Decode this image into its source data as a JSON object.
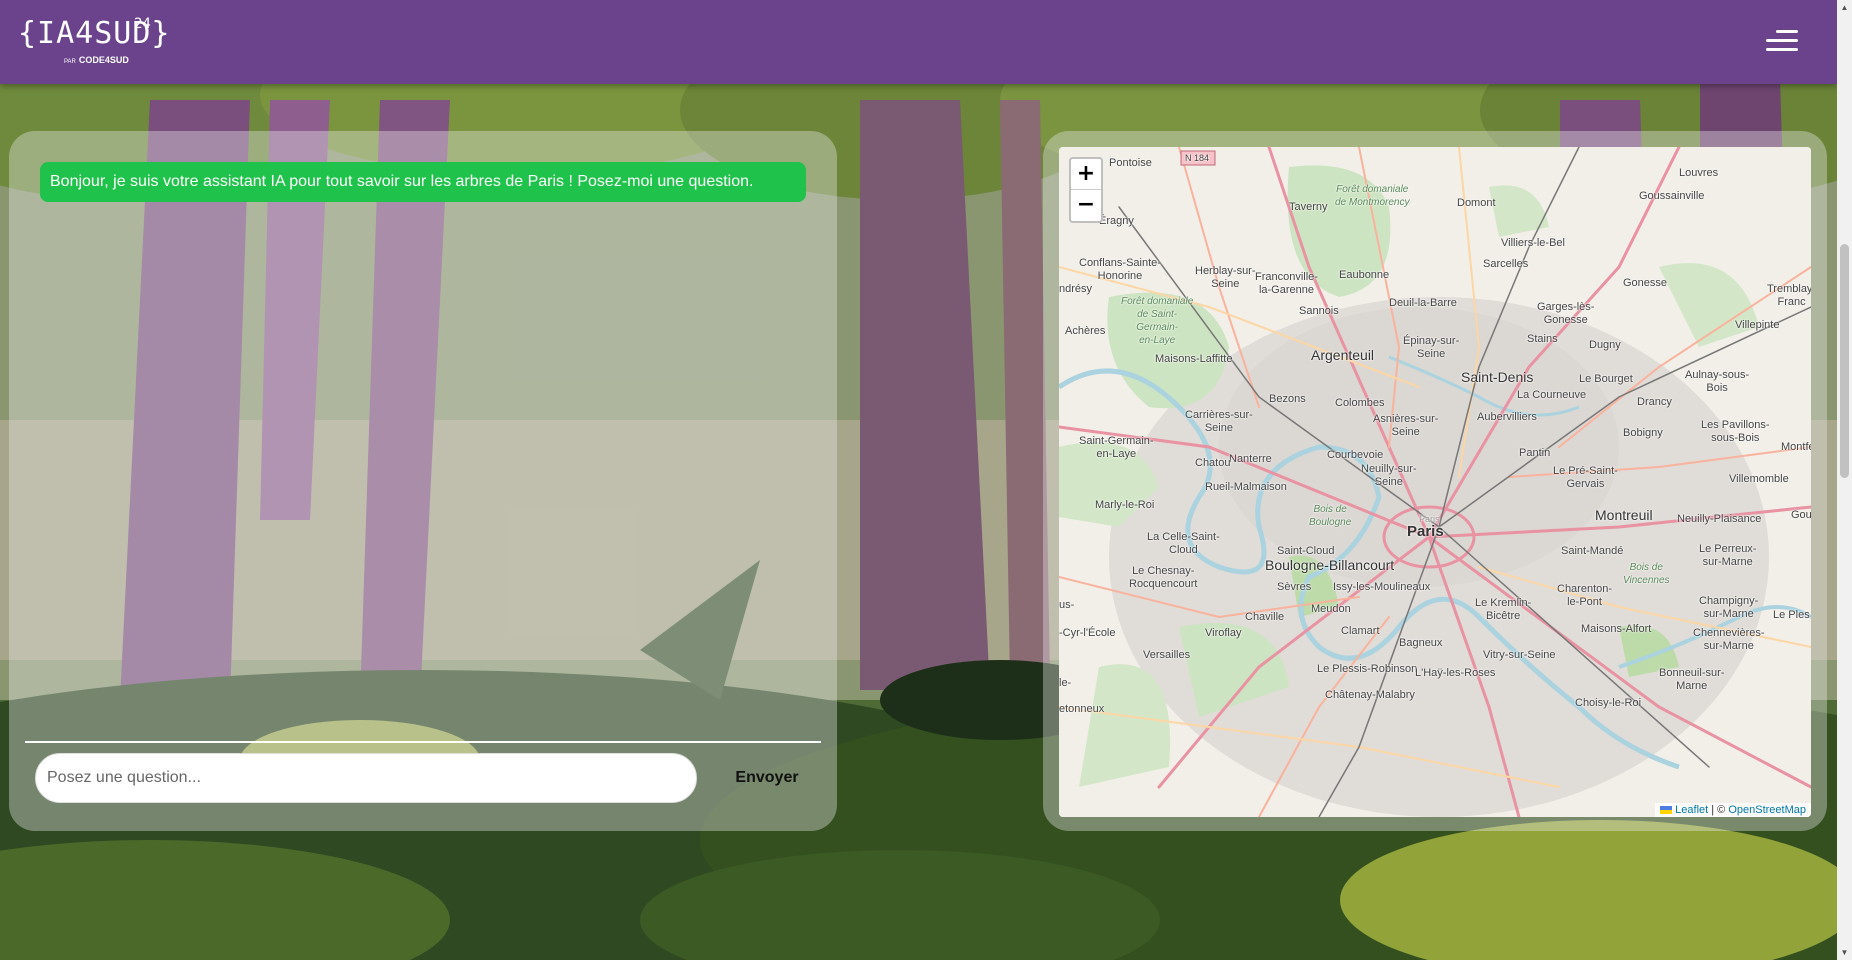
{
  "header": {
    "logo_text": "{IA4SUD}",
    "logo_superscript": "24",
    "logo_by_prefix": "PAR",
    "logo_by": "CODE4SUD",
    "menu_icon": "hamburger-menu-icon"
  },
  "chat": {
    "bot_message": "Bonjour, je suis votre assistant IA pour tout savoir sur les arbres de Paris ! Posez-moi une question.",
    "input_placeholder": "Posez une question...",
    "input_value": "",
    "send_label": "Envoyer",
    "bot_message_color": "#1fc24a"
  },
  "map": {
    "zoom_in": "+",
    "zoom_out": "−",
    "attribution_leaflet": "Leaflet",
    "attribution_separator": " | © ",
    "attribution_osm": "OpenStreetMap",
    "places": {
      "paris": "Paris",
      "argenteuil": "Argenteuil",
      "saint_denis": "Saint-Denis",
      "boulogne": "Boulogne-Billancourt",
      "montreuil": "Montreuil",
      "pontoise": "Pontoise",
      "taverny": "Taverny",
      "domont": "Domont",
      "louvres": "Louvres",
      "goussainville": "Goussainville",
      "eragny": "Éragny",
      "villiers_le_bel": "Villiers-le-Bel",
      "sarcelles": "Sarcelles",
      "gonesse": "Gonesse",
      "eaubonne": "Eaubonne",
      "franconville": "Franconville-\nla-Garenne",
      "herblay": "Herblay-sur-\nSeine",
      "conflans": "Conflans-Sainte-\nHonorine",
      "deuil": "Deuil-la-Barre",
      "garges": "Garges-lès-\nGonesse",
      "tremblay": "Tremblay-\nFranc",
      "villepinte": "Villepinte",
      "sannois": "Sannois",
      "stains": "Stains",
      "dugny": "Dugny",
      "epinay": "Épinay-sur-\nSeine",
      "acheres": "Achères",
      "maisons_laffitte": "Maisons-Laffitte",
      "aulnay": "Aulnay-sous-\nBois",
      "le_bourget": "Le Bourget",
      "bezons": "Bezons",
      "colombes": "Colombes",
      "la_courneuve": "La Courneuve",
      "drancy": "Drancy",
      "aubervilliers": "Aubervilliers",
      "asnieres": "Asnières-sur-\nSeine",
      "bobigny": "Bobigny",
      "pavillons": "Les Pavillons-\nsous-Bois",
      "carrieres": "Carrières-sur-\nSeine",
      "saint_germain": "Saint-Germain-\nen-Laye",
      "nanterre": "Nanterre",
      "courbevoie": "Courbevoie",
      "neuilly": "Neuilly-sur-\nSeine",
      "pantin": "Pantin",
      "pre_saint_gervais": "Le Pré-Saint-\nGervais",
      "chatou": "Chatou",
      "rueil": "Rueil-Malmaison",
      "villemomble": "Villemomble",
      "marly": "Marly-le-Roi",
      "neuilly_plaisance": "Neuilly-Plaisance",
      "la_celle": "La Celle-Saint-\nCloud",
      "saint_cloud": "Saint-Cloud",
      "saint_mande": "Saint-Mandé",
      "perreux": "Le Perreux-\nsur-Marne",
      "chesnay": "Le Chesnay-\nRocquencourt",
      "sevres": "Sèvres",
      "issy": "Issy-les-Moulineaux",
      "charenton": "Charenton-\nle-Pont",
      "champigny": "Champigny-\nsur-Marne",
      "versailles": "Versailles",
      "meudon": "Meudon",
      "kremlin": "Le Kremlin-\nBicêtre",
      "chaville": "Chaville",
      "viroflay": "Viroflay",
      "clamart": "Clamart",
      "maisons_alfort": "Maisons-Alfort",
      "chennevieres": "Chennevières-\nsur-Marne",
      "bagneux": "Bagneux",
      "vitry": "Vitry-sur-Seine",
      "saint_cyr": "-Cyr-l'École",
      "plessis": "Le Plessis-Robinson",
      "hay": "L'Haÿ-les-Roses",
      "bonneuil": "Bonneuil-sur-\nMarne",
      "chatenay": "Châtenay-Malabry",
      "choisy": "Choisy-le-Roi",
      "andresy": "ndrésy",
      "montfe": "Montfe",
      "gou": "Gou",
      "le_ples": "Le Ples",
      "etonneux": "etonneux",
      "le_label": "le-",
      "us_label": "us-",
      "forest_montmorency": "Forêt domaniale\nde Montmorency",
      "forest_saint_germain": "Forêt domaniale\nde Saint-\nGermain-\nen-Laye",
      "bois_boulogne": "Bois de\nBoulogne",
      "bois_vincennes": "Bois de\nVincennes",
      "paris_small": "Paris",
      "n184": "N 184"
    }
  }
}
